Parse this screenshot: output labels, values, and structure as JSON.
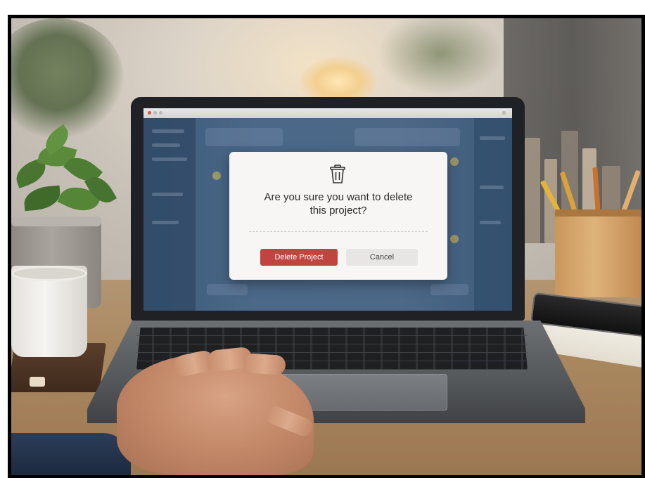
{
  "dialog": {
    "icon": "trash-icon",
    "title_line1": "Are you sure you want to delete",
    "title_line2": "this project?",
    "delete_button_label": "Delete Project",
    "cancel_button_label": "Cancel"
  },
  "colors": {
    "delete_button": "#c0443f",
    "cancel_button": "#e7e6e4",
    "dialog_background": "#f7f6f4",
    "app_background": "#5c7ea3"
  }
}
